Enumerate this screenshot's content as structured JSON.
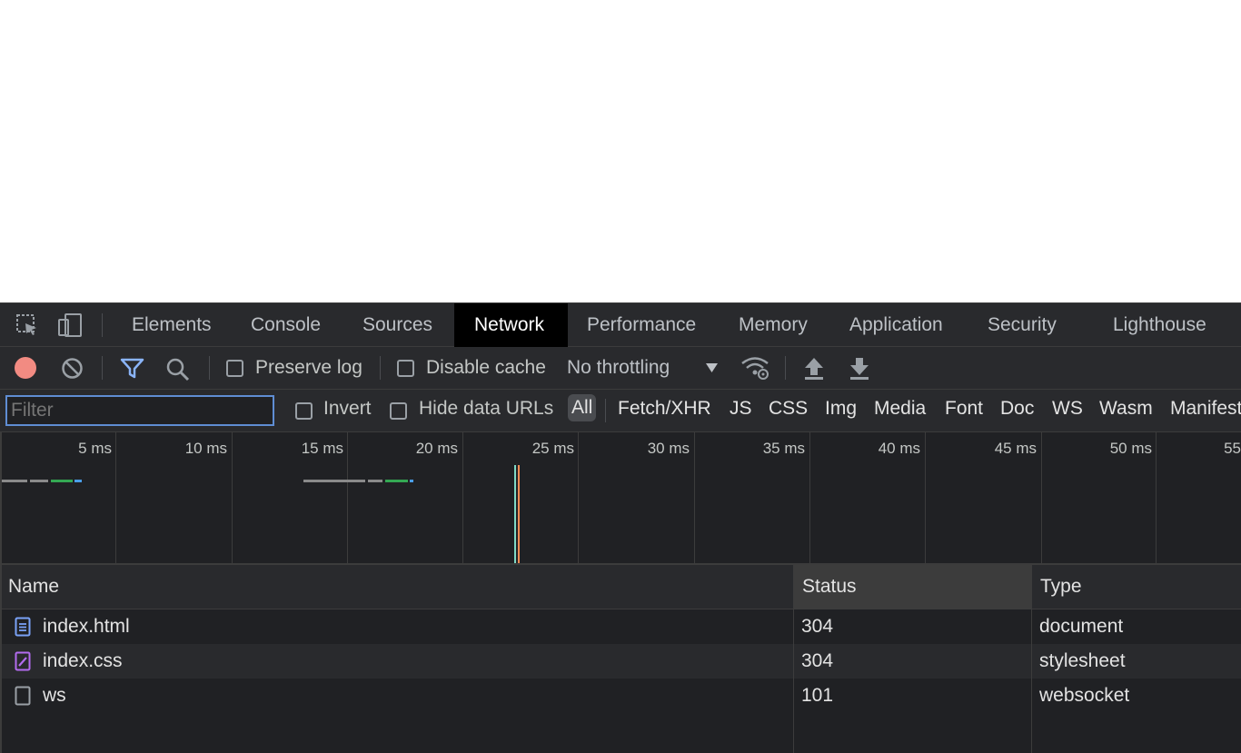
{
  "tabs": [
    "Elements",
    "Console",
    "Sources",
    "Network",
    "Performance",
    "Memory",
    "Application",
    "Security",
    "Lighthouse"
  ],
  "active_tab": "Network",
  "toolbar": {
    "preserve_log_label": "Preserve log",
    "disable_cache_label": "Disable cache",
    "throttling_value": "No throttling",
    "record_color": "#f28b82",
    "filter_icon_color": "#8ab4f8"
  },
  "filter": {
    "placeholder": "Filter",
    "invert_label": "Invert",
    "hide_data_urls_label": "Hide data URLs",
    "types": [
      "All",
      "Fetch/XHR",
      "JS",
      "CSS",
      "Img",
      "Media",
      "Font",
      "Doc",
      "WS",
      "Wasm",
      "Manifest"
    ],
    "selected_type": "All"
  },
  "overview": {
    "ticks": [
      "5 ms",
      "10 ms",
      "15 ms",
      "20 ms",
      "25 ms",
      "30 ms",
      "35 ms",
      "40 ms",
      "45 ms",
      "50 ms",
      "55"
    ]
  },
  "table": {
    "columns": [
      "Name",
      "Status",
      "Type"
    ],
    "sorted_column": "Status",
    "rows": [
      {
        "name": "index.html",
        "status": "304",
        "type": "document",
        "icon": "document-icon"
      },
      {
        "name": "index.css",
        "status": "304",
        "type": "stylesheet",
        "icon": "stylesheet-icon"
      },
      {
        "name": "ws",
        "status": "101",
        "type": "websocket",
        "icon": "websocket-icon"
      }
    ]
  }
}
